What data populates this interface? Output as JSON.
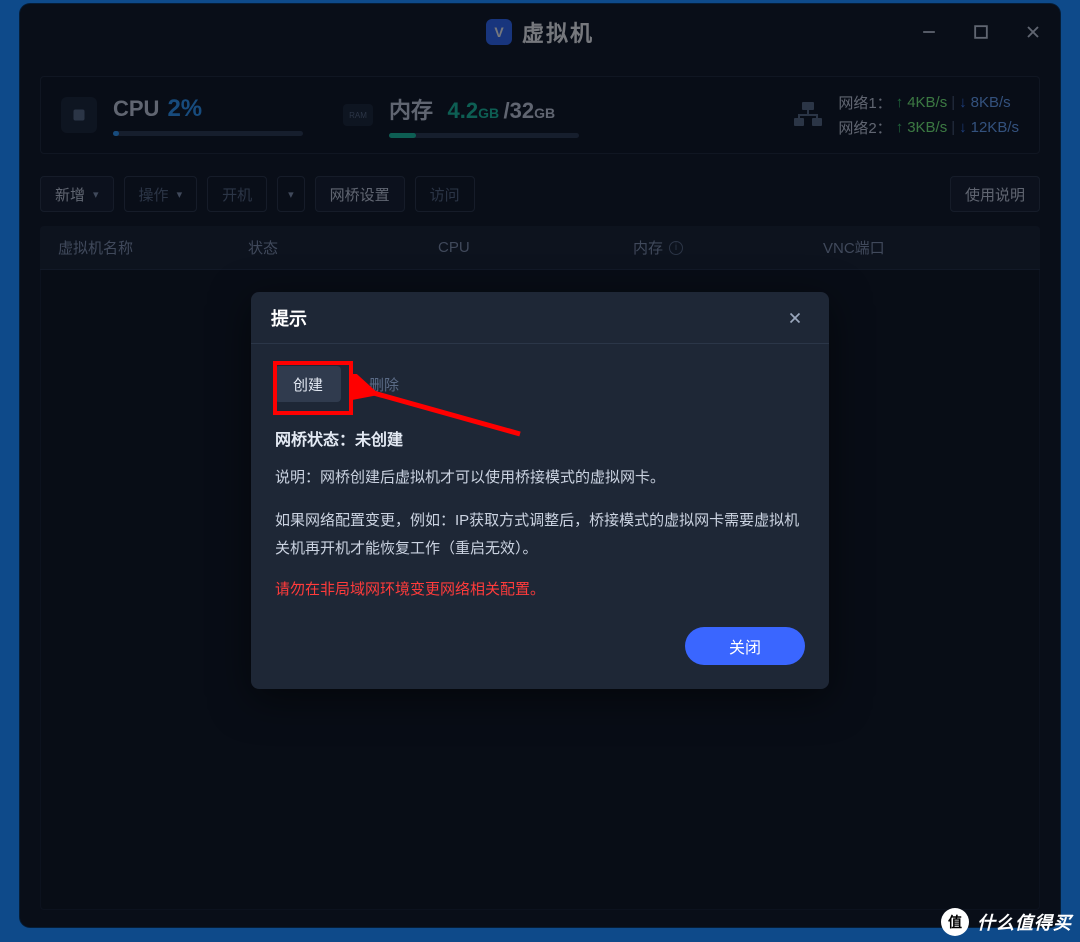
{
  "window": {
    "title": "虚拟机",
    "icon_letter": "V"
  },
  "stats": {
    "cpu": {
      "label": "CPU",
      "value": "2%",
      "fill_pct": 3
    },
    "mem": {
      "label": "内存",
      "used_value": "4.2",
      "used_unit": "GB",
      "slash": "/",
      "total_value": "32",
      "total_unit": "GB",
      "fill_pct": 14
    },
    "net": [
      {
        "name": "网络1：",
        "up": "4KB/s",
        "down": "8KB/s"
      },
      {
        "name": "网络2：",
        "up": "3KB/s",
        "down": "12KB/s"
      }
    ]
  },
  "toolbar": {
    "add": "新增",
    "ops": "操作",
    "power": "开机",
    "bridge": "网桥设置",
    "visit": "访问",
    "help": "使用说明"
  },
  "table": {
    "headers": {
      "name": "虚拟机名称",
      "status": "状态",
      "cpu": "CPU",
      "mem": "内存",
      "vnc": "VNC端口"
    }
  },
  "modal": {
    "title": "提示",
    "create_btn": "创建",
    "delete_btn": "删除",
    "status_label": "网桥状态：",
    "status_value": "未创建",
    "desc_l1": "说明：网桥创建后虚拟机才可以使用桥接模式的虚拟网卡。",
    "desc_l2": "如果网络配置变更，例如：IP获取方式调整后，桥接模式的虚拟网卡需要虚拟机关机再开机才能恢复工作（重启无效）。",
    "warn": "请勿在非局域网环境变更网络相关配置。",
    "close_btn": "关闭"
  },
  "watermark": {
    "badge": "值",
    "text": "什么值得买"
  }
}
